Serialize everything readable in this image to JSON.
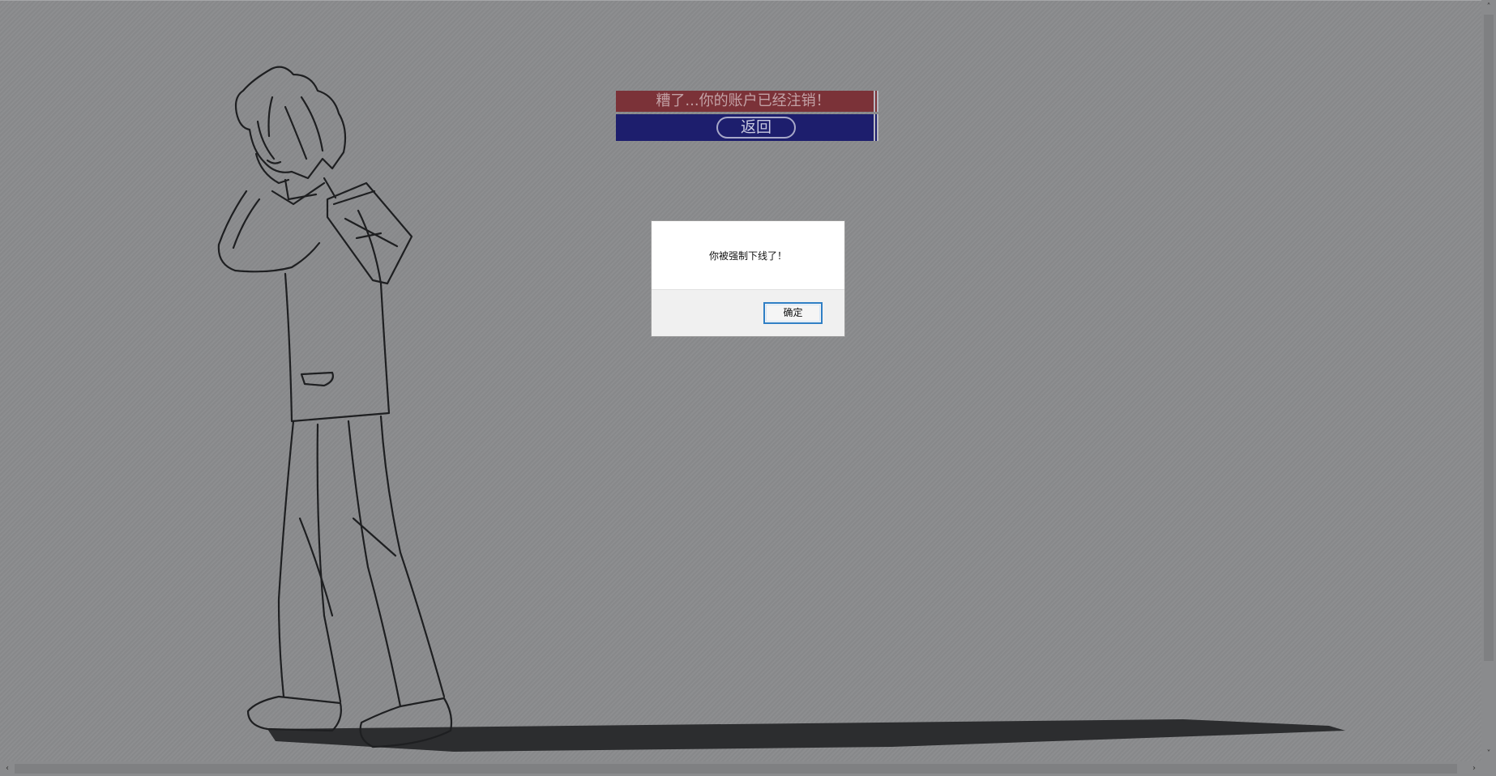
{
  "page": {
    "notice": "糟了...你的账户已经注销！",
    "return_label": "返回"
  },
  "dialog": {
    "message": "你被强制下线了！",
    "ok_label": "确定"
  },
  "colors": {
    "overlay_bg": "#8a8b8d",
    "notice_bg": "#7b3238",
    "return_bg": "#1d1e6d",
    "dialog_button_border": "#2f7fc5"
  },
  "icons": {
    "scroll_up": "chevron-up-icon",
    "scroll_down": "chevron-down-icon",
    "scroll_left": "chevron-left-icon",
    "scroll_right": "chevron-right-icon"
  }
}
